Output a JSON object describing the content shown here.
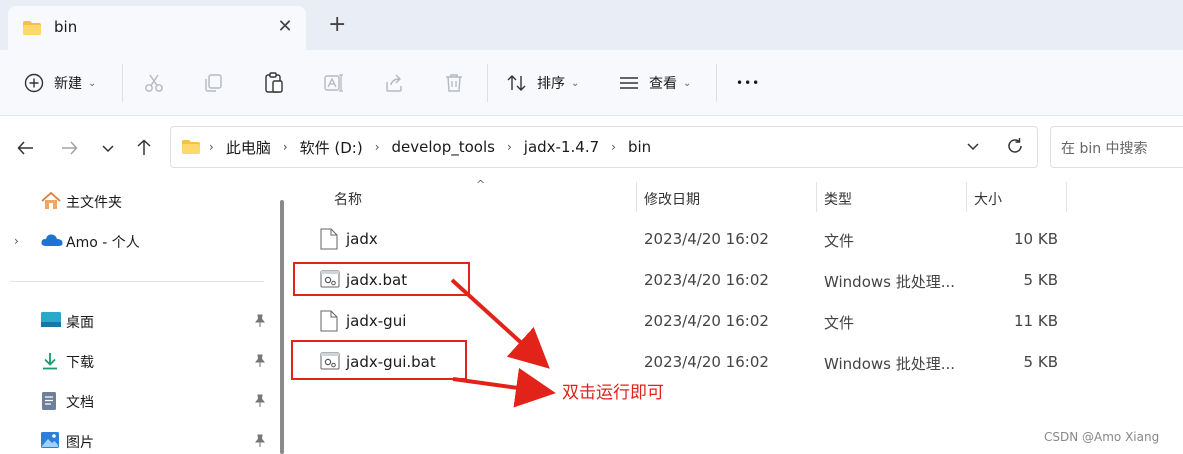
{
  "tab": {
    "title": "bin",
    "close": "✕",
    "new_tab": "+"
  },
  "commands": {
    "new_label": "新建",
    "sort_label": "排序",
    "view_label": "查看",
    "more": "•••"
  },
  "address": {
    "crumbs": [
      "此电脑",
      "软件 (D:)",
      "develop_tools",
      "jadx-1.4.7",
      "bin"
    ],
    "search_placeholder": "在 bin 中搜索"
  },
  "nav": {
    "home": "主文件夹",
    "onedrive": "Amo - 个人",
    "desktop": "桌面",
    "downloads": "下载",
    "documents": "文档",
    "pictures": "图片"
  },
  "columns": {
    "name": "名称",
    "date": "修改日期",
    "type": "类型",
    "size": "大小"
  },
  "files": [
    {
      "name": "jadx",
      "date": "2023/4/20 16:02",
      "type": "文件",
      "size": "10 KB",
      "kind": "file"
    },
    {
      "name": "jadx.bat",
      "date": "2023/4/20 16:02",
      "type": "Windows 批处理...",
      "size": "5 KB",
      "kind": "bat"
    },
    {
      "name": "jadx-gui",
      "date": "2023/4/20 16:02",
      "type": "文件",
      "size": "11 KB",
      "kind": "file"
    },
    {
      "name": "jadx-gui.bat",
      "date": "2023/4/20 16:02",
      "type": "Windows 批处理...",
      "size": "5 KB",
      "kind": "bat"
    }
  ],
  "annotation": {
    "text": "双击运行即可",
    "color": "#e2231a"
  },
  "watermark": "CSDN @Amo Xiang"
}
